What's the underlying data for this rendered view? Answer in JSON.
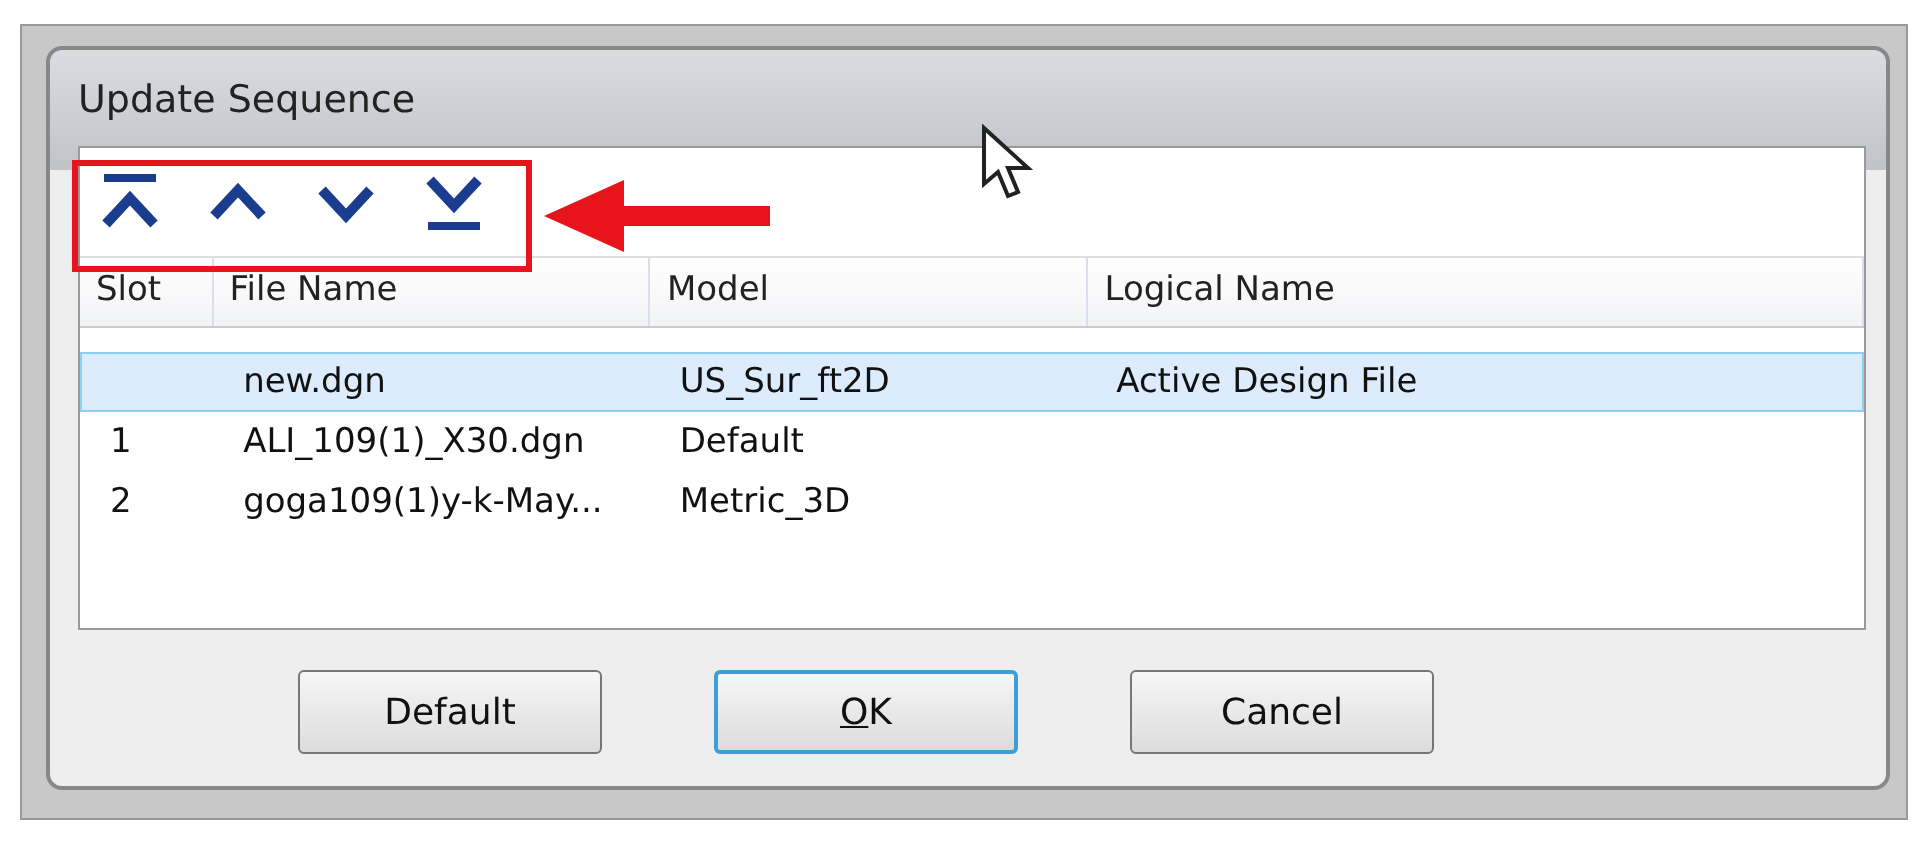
{
  "window": {
    "title": "Update Sequence"
  },
  "toolbar": [
    {
      "kind": "top"
    },
    {
      "kind": "up"
    },
    {
      "kind": "down"
    },
    {
      "kind": "bottom"
    }
  ],
  "table": {
    "columns": [
      "Slot",
      "File Name",
      "Model",
      "Logical Name"
    ],
    "rows": [
      {
        "cells": [
          "",
          "new.dgn",
          "US_Sur_ft2D",
          "Active Design File"
        ],
        "selected": true
      },
      {
        "cells": [
          "1",
          "ALI_109(1)_X30.dgn",
          "Default",
          ""
        ],
        "selected": false
      },
      {
        "cells": [
          "2",
          "goga109(1)y-k-May...",
          "Metric_3D",
          ""
        ],
        "selected": false
      }
    ]
  },
  "buttons": [
    {
      "label": "Default",
      "default": false,
      "mnemonic": false
    },
    {
      "label": "OK",
      "default": true,
      "mnemonic": true
    },
    {
      "label": "Cancel",
      "default": false,
      "mnemonic": false
    }
  ]
}
